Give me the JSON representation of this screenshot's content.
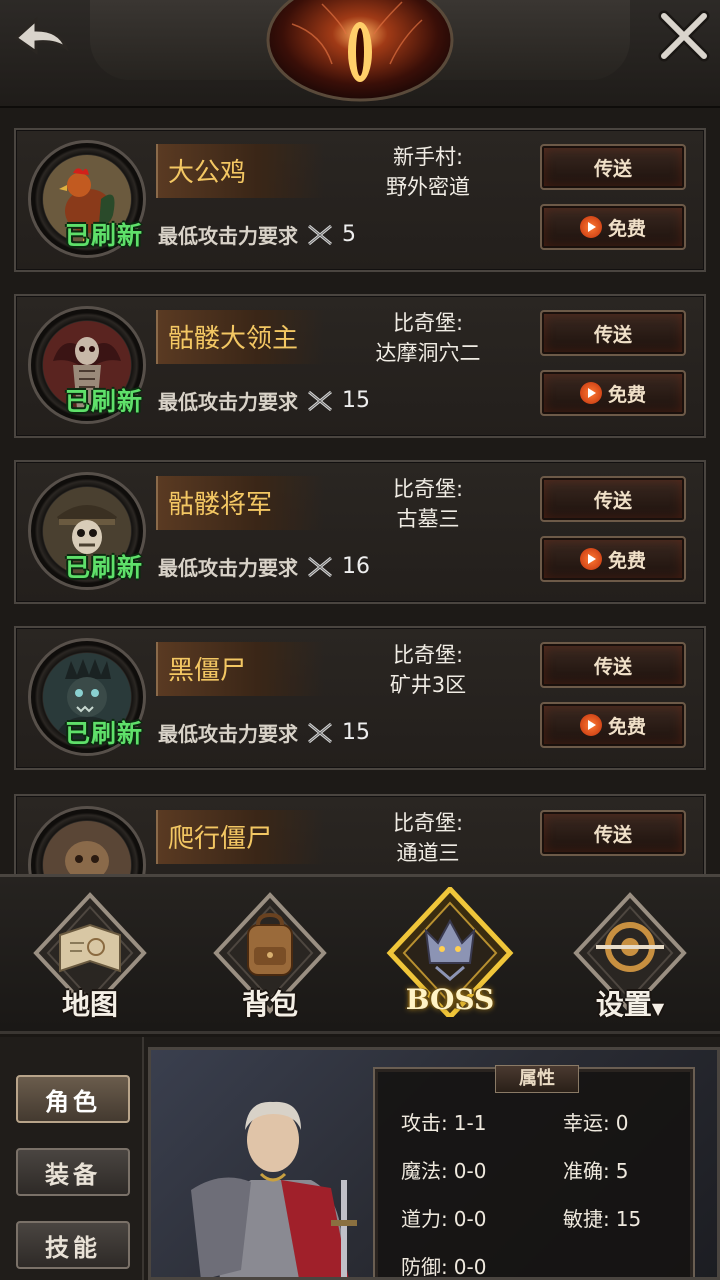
{
  "header": {
    "back_label": "",
    "close_label": ""
  },
  "bosses": [
    {
      "name": "大公鸡",
      "location_line1": "新手村:",
      "location_line2": "野外密道",
      "status": "已刷新",
      "req_label": "最低攻击力要求",
      "req_value": "5",
      "teleport_label": "传送",
      "free_label": "免费",
      "portrait": "rooster"
    },
    {
      "name": "骷髅大领主",
      "location_line1": "比奇堡:",
      "location_line2": "达摩洞穴二",
      "status": "已刷新",
      "req_label": "最低攻击力要求",
      "req_value": "15",
      "teleport_label": "传送",
      "free_label": "免费",
      "portrait": "skeleton-lord"
    },
    {
      "name": "骷髅将军",
      "location_line1": "比奇堡:",
      "location_line2": "古墓三",
      "status": "已刷新",
      "req_label": "最低攻击力要求",
      "req_value": "16",
      "teleport_label": "传送",
      "free_label": "免费",
      "portrait": "skeleton-general"
    },
    {
      "name": "黑僵尸",
      "location_line1": "比奇堡:",
      "location_line2": "矿井3区",
      "status": "已刷新",
      "req_label": "最低攻击力要求",
      "req_value": "15",
      "teleport_label": "传送",
      "free_label": "免费",
      "portrait": "black-zombie"
    },
    {
      "name": "爬行僵尸",
      "location_line1": "比奇堡:",
      "location_line2": "通道三",
      "teleport_label": "传送",
      "portrait": "crawling-zombie"
    }
  ],
  "nav": [
    {
      "label": "地图",
      "icon": "map-icon"
    },
    {
      "label": "背包",
      "icon": "backpack-icon"
    },
    {
      "label": "BOSS",
      "icon": "boss-icon",
      "active": true
    },
    {
      "label": "设置",
      "icon": "settings-icon"
    }
  ],
  "side_tabs": [
    {
      "label": "角色",
      "active": true
    },
    {
      "label": "装备"
    },
    {
      "label": "技能"
    }
  ],
  "attributes": {
    "title": "属性",
    "attack_k": "攻击:",
    "attack_v": "1-1",
    "luck_k": "幸运:",
    "luck_v": "0",
    "magic_k": "魔法:",
    "magic_v": "0-0",
    "accuracy_k": "准确:",
    "accuracy_v": "5",
    "tao_k": "道力:",
    "tao_v": "0-0",
    "agility_k": "敏捷:",
    "agility_v": "15",
    "defense_k": "防御:",
    "defense_v": "0-0"
  },
  "colors": {
    "name_gold": "#f3c763",
    "refreshed_green": "#5fe06a",
    "panel_bg": "#1d1a17"
  }
}
